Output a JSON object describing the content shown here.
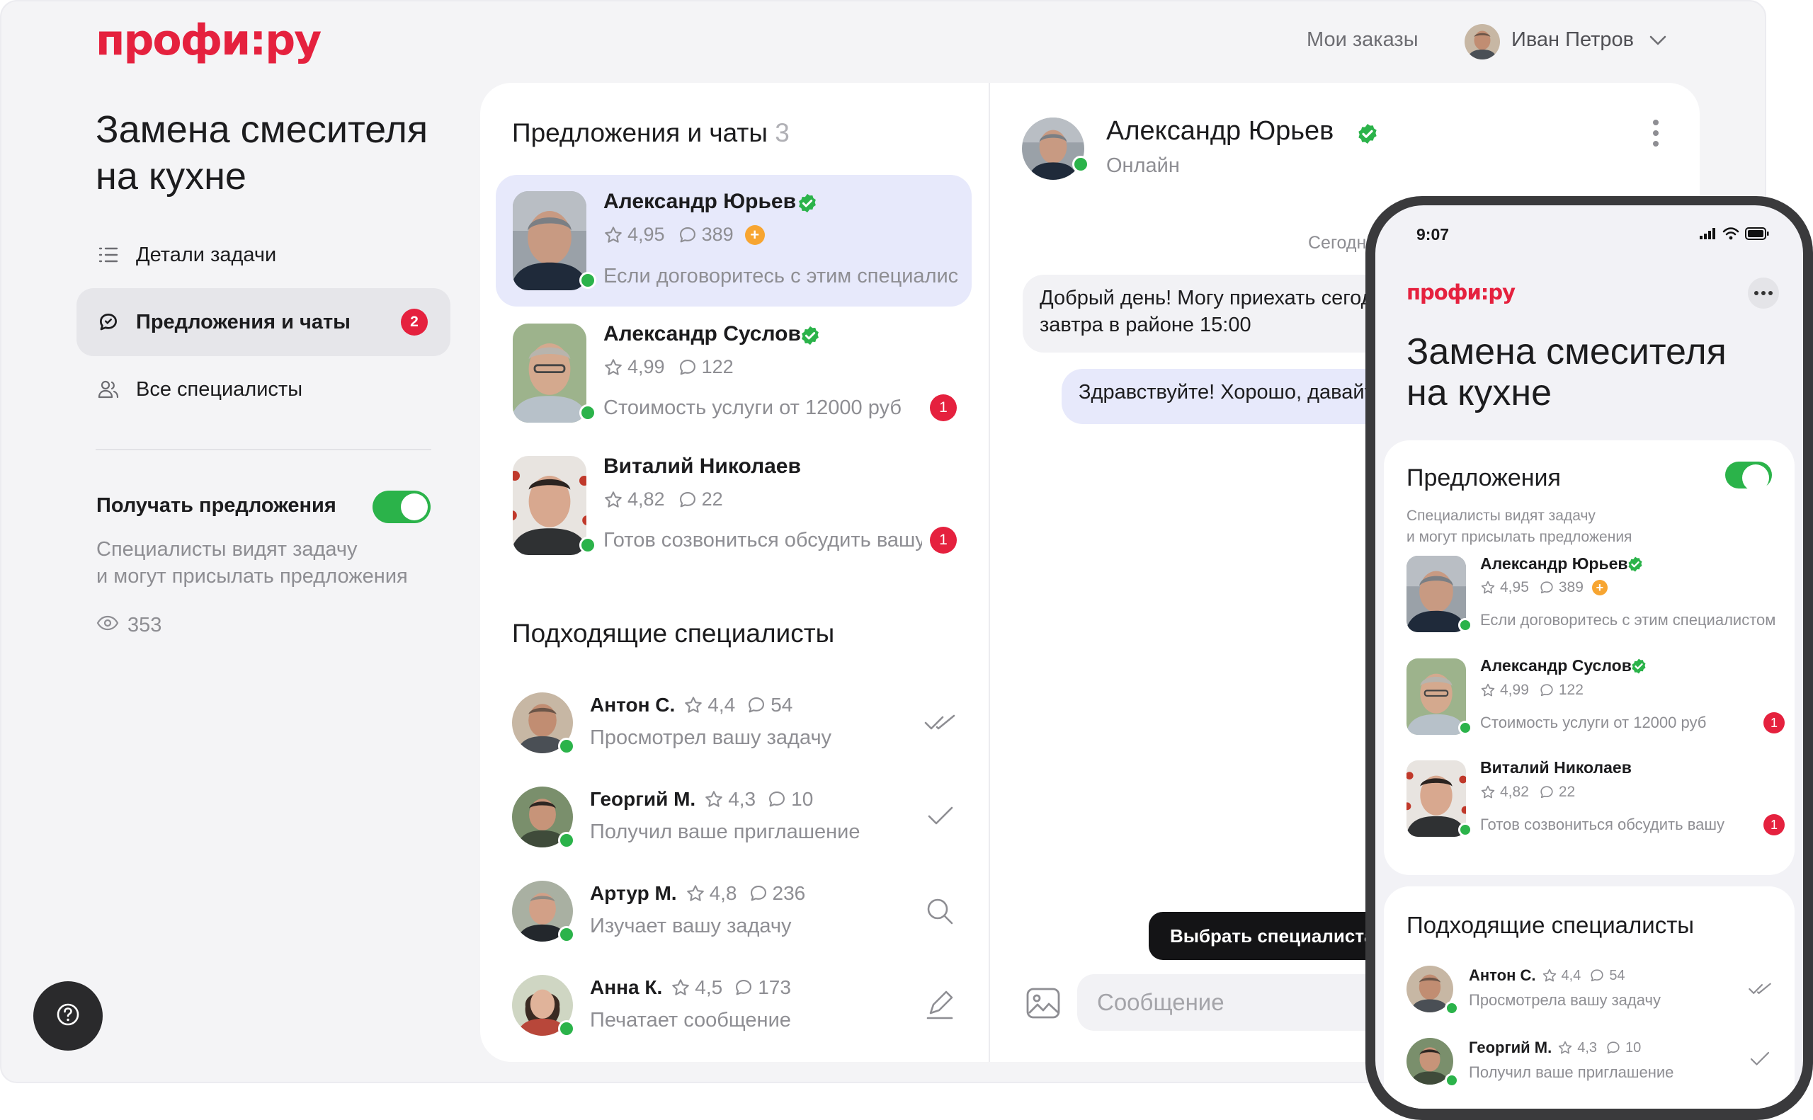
{
  "brand": {
    "logo": "профи:ру",
    "accent": "#e5213e",
    "success": "#2bb34a"
  },
  "header": {
    "my_orders": "Мои заказы",
    "user_name": "Иван Петров",
    "chevron_icon": "chevron-down-icon"
  },
  "task": {
    "title": "Замена смесителя на кухне"
  },
  "sidebar": {
    "items": [
      {
        "label": "Детали задачи",
        "icon": "list-icon"
      },
      {
        "label": "Предложения и чаты",
        "icon": "chat-icon",
        "badge": "2"
      },
      {
        "label": "Все специалисты",
        "icon": "people-icon"
      }
    ],
    "receive": {
      "title": "Получать предложения",
      "description_line1": "Специалисты видят задачу",
      "description_line2": "и могут присылать предложения",
      "views": "353",
      "toggle_on": true
    }
  },
  "offers": {
    "title": "Предложения и чаты",
    "count": "3",
    "items": [
      {
        "name": "Александр Юрьев",
        "rating": "4,95",
        "reviews": "389",
        "snippet": "Если договоритесь с этим специалистом",
        "unread": ""
      },
      {
        "name": "Александр Суслов",
        "rating": "4,99",
        "reviews": "122",
        "snippet": "Стоимость услуги от 12000 руб",
        "unread": "1"
      },
      {
        "name": "Виталий Николаев",
        "rating": "4,82",
        "reviews": "22",
        "snippet": "Готов созвониться обсудить вашу задачу",
        "unread": "1"
      }
    ]
  },
  "specialists": {
    "title": "Подходящие специалисты",
    "items": [
      {
        "name": "Антон С.",
        "rating": "4,4",
        "reviews": "54",
        "status": "Просмотрел вашу задачу",
        "icon": "double-check-icon"
      },
      {
        "name": "Георгий М.",
        "rating": "4,3",
        "reviews": "10",
        "status": "Получил ваше приглашение",
        "icon": "check-icon"
      },
      {
        "name": "Артур М.",
        "rating": "4,8",
        "reviews": "236",
        "status": "Изучает вашу задачу",
        "icon": "search-icon"
      },
      {
        "name": "Анна К.",
        "rating": "4,5",
        "reviews": "173",
        "status": "Печатает сообщение",
        "icon": "pen-icon"
      }
    ]
  },
  "chat": {
    "name": "Александр Юрьев",
    "status": "Онлайн",
    "date": "Сегодня",
    "incoming_line1": "Добрый день! Могу приехать сегодня или",
    "incoming_line2": "завтра в районе 15:00",
    "outgoing": "Здравствуйте! Хорошо, давайте завтра",
    "choose_button": "Выбрать специалиста",
    "message_placeholder": "Сообщение"
  },
  "mobile": {
    "time": "9:07",
    "logo": "профи:ру",
    "title": "Замена смесителя на кухне",
    "offers_title": "Предложения",
    "offers_desc_line1": "Специалисты видят задачу",
    "offers_desc_line2": "и могут присылать предложения",
    "offers": [
      {
        "name": "Александр Юрьев",
        "rating": "4,95",
        "reviews": "389",
        "snippet": "Если договоритесь с этим специалистом",
        "unread": ""
      },
      {
        "name": "Александр Суслов",
        "rating": "4,99",
        "reviews": "122",
        "snippet": "Стоимость услуги от 12000 руб",
        "unread": "1"
      },
      {
        "name": "Виталий Николаев",
        "rating": "4,82",
        "reviews": "22",
        "snippet": "Готов созвониться обсудить вашу",
        "unread": "1"
      }
    ],
    "specialists_title": "Подходящие специалисты",
    "specialists": [
      {
        "name": "Антон С.",
        "rating": "4,4",
        "reviews": "54",
        "status": "Просмотрела вашу задачу"
      },
      {
        "name": "Георгий М.",
        "rating": "4,3",
        "reviews": "10",
        "status": "Получил ваше приглашение"
      }
    ]
  }
}
